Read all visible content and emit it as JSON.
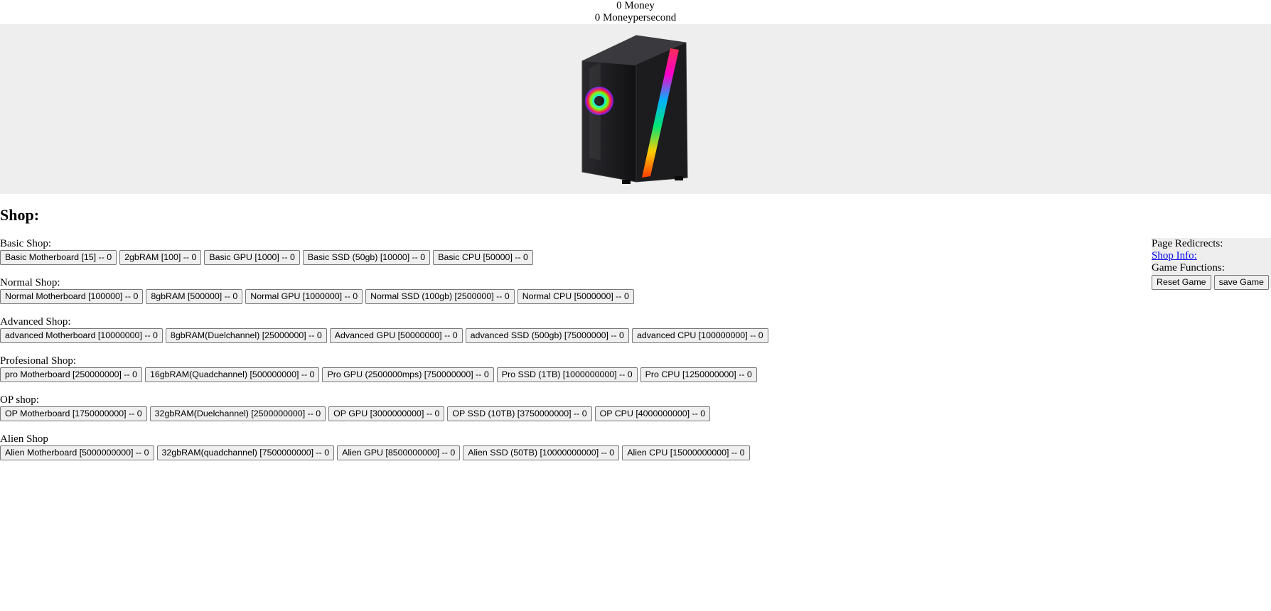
{
  "stats": {
    "money": "0 Money",
    "money_per_second": "0 Moneypersecond"
  },
  "clicker": {
    "image": "gaming-pc-case-icon",
    "accent_colors": [
      "#ff2d55",
      "#ffcc00",
      "#00e676",
      "#00b0ff",
      "#aa00ff"
    ]
  },
  "shop": {
    "title": "Shop:",
    "sections": [
      {
        "label": "Basic Shop:",
        "items": [
          "Basic Motherboard [15] -- 0",
          "2gbRAM [100] -- 0",
          "Basic GPU [1000] -- 0",
          "Basic SSD (50gb) [10000] -- 0",
          "Basic CPU [50000] -- 0"
        ]
      },
      {
        "label": "Normal Shop:",
        "items": [
          "Normal Motherboard [100000] -- 0",
          "8gbRAM [500000] -- 0",
          "Normal GPU [1000000] -- 0",
          "Normal SSD (100gb) [2500000] -- 0",
          "Normal CPU [5000000] -- 0"
        ]
      },
      {
        "label": "Advanced Shop:",
        "items": [
          "advanced Motherboard [10000000] -- 0",
          "8gbRAM(Duelchannel) [25000000] -- 0",
          "Advanced GPU [50000000] -- 0",
          "advanced SSD (500gb) [75000000] -- 0",
          "advanced CPU [100000000] -- 0"
        ]
      },
      {
        "label": "Profesional Shop:",
        "items": [
          "pro Motherboard [250000000] -- 0",
          "16gbRAM(Quadchannel) [500000000] -- 0",
          "Pro GPU (2500000mps) [750000000] -- 0",
          "Pro SSD (1TB) [1000000000] -- 0",
          "Pro CPU [1250000000] -- 0"
        ]
      },
      {
        "label": "OP shop:",
        "items": [
          "OP Motherboard [1750000000] -- 0",
          "32gbRAM(Duelchannel) [2500000000] -- 0",
          "OP GPU [3000000000] -- 0",
          "OP SSD (10TB) [3750000000] -- 0",
          "OP CPU [4000000000] -- 0"
        ]
      },
      {
        "label": "Alien Shop",
        "items": [
          "Alien Motherboard [5000000000] -- 0",
          "32gbRAM(quadchannel) [7500000000] -- 0",
          "Alien GPU [8500000000] -- 0",
          "Alien SSD (50TB) [10000000000] -- 0",
          "Alien CPU [15000000000] -- 0"
        ]
      }
    ]
  },
  "side_panel": {
    "page_redirects": "Page Redicrects:",
    "shop_info_link": "Shop Info:",
    "game_functions": "Game Functions:",
    "reset_button": "Reset Game",
    "save_button": "save Game"
  }
}
